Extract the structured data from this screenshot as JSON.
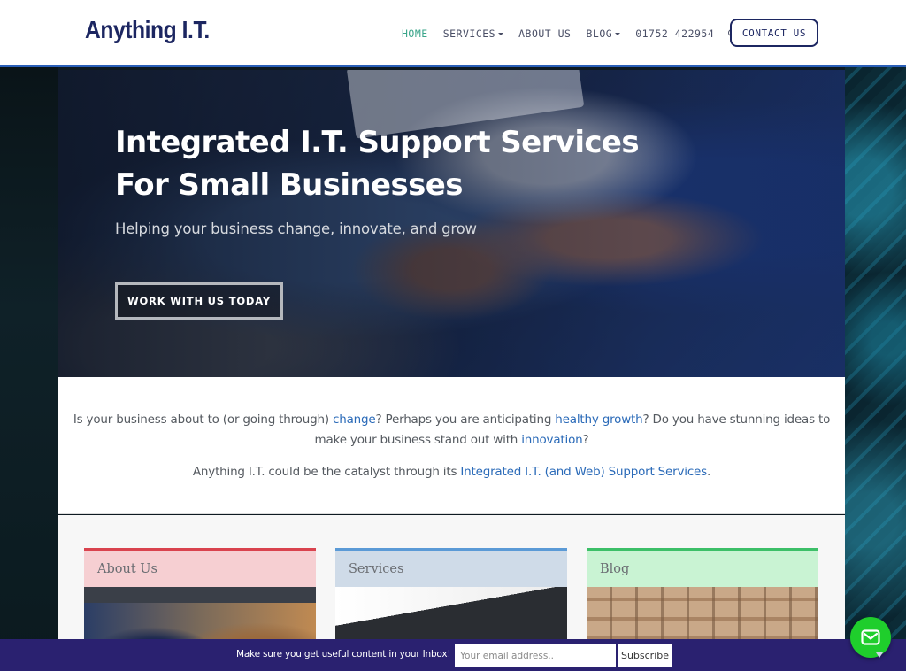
{
  "header": {
    "logo": "Anything I.T.",
    "nav": {
      "home": "HOME",
      "services": "SERVICES",
      "about": "ABOUT US",
      "blog": "BLOG",
      "phone": "01752 422954"
    },
    "contact_label": "CONTACT US"
  },
  "hero": {
    "title_line1": "Integrated I.T. Support Services",
    "title_line2": "For Small Businesses",
    "subtitle": "Helping your business change, innovate, and grow",
    "cta": "WORK WITH US TODAY"
  },
  "intro": {
    "p1_a": "Is your business about to (or going through) ",
    "p1_link1": "change",
    "p1_b": "? Perhaps you are anticipating ",
    "p1_link2": "healthy growth",
    "p1_c": "? Do you have stunning ideas to make your business stand out with ",
    "p1_link3": "innovation",
    "p1_d": "?",
    "p2_a": "Anything I.T. could be the catalyst through its ",
    "p2_link": "Integrated I.T. (and Web) Support Services",
    "p2_b": "."
  },
  "cards": [
    {
      "title": "About Us"
    },
    {
      "title": "Services"
    },
    {
      "title": "Blog"
    }
  ],
  "subscribe": {
    "text": "Make sure you get useful content in your Inbox!",
    "placeholder": "Your email address..",
    "button": "Subscribe"
  },
  "colors": {
    "brand_navy": "#1c2661",
    "nav_active": "#3aa58a",
    "link_blue": "#2a6ab8",
    "subscribe_bar": "#2a2170",
    "chat_green": "#1fce2c"
  },
  "icons": {
    "search": "search-icon",
    "chat": "envelope-icon"
  }
}
